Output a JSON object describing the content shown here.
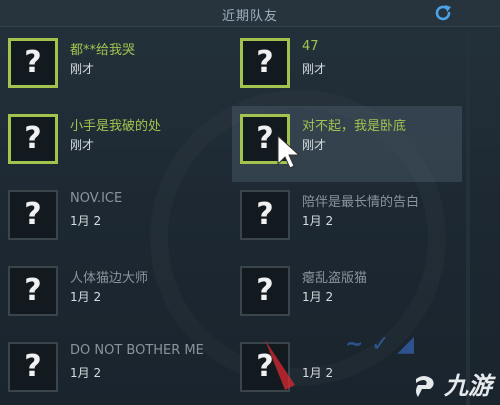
{
  "header": {
    "title": "近期队友",
    "refresh_icon": "refresh-icon"
  },
  "avatar_placeholder": "?",
  "friends": [
    {
      "name": "都**给我哭",
      "time": "刚才",
      "online": true
    },
    {
      "name": "47",
      "time": "刚才",
      "online": true
    },
    {
      "name": "小手是我破的处",
      "time": "刚才",
      "online": true
    },
    {
      "name": "对不起，我是卧底",
      "time": "刚才",
      "online": true
    },
    {
      "name": "NOV.ICE",
      "time": "1月 2",
      "online": false
    },
    {
      "name": "陪伴是最长情的告白",
      "time": "1月 2",
      "online": false
    },
    {
      "name": "人体猫边大师",
      "time": "1月 2",
      "online": false
    },
    {
      "name": "瘪乱盗版猫",
      "time": "1月 2",
      "online": false
    },
    {
      "name": "DO NOT BOTHER ME",
      "time": "1月 2",
      "online": false
    },
    {
      "name": "",
      "time": "1月 2",
      "online": false
    }
  ],
  "watermark": {
    "text": "九游",
    "logo_icon": "jiuyou-logo-icon"
  },
  "colors": {
    "online_accent": "#a3c34f",
    "offline_name": "#8a949b",
    "refresh_blue": "#4aa3e8"
  }
}
